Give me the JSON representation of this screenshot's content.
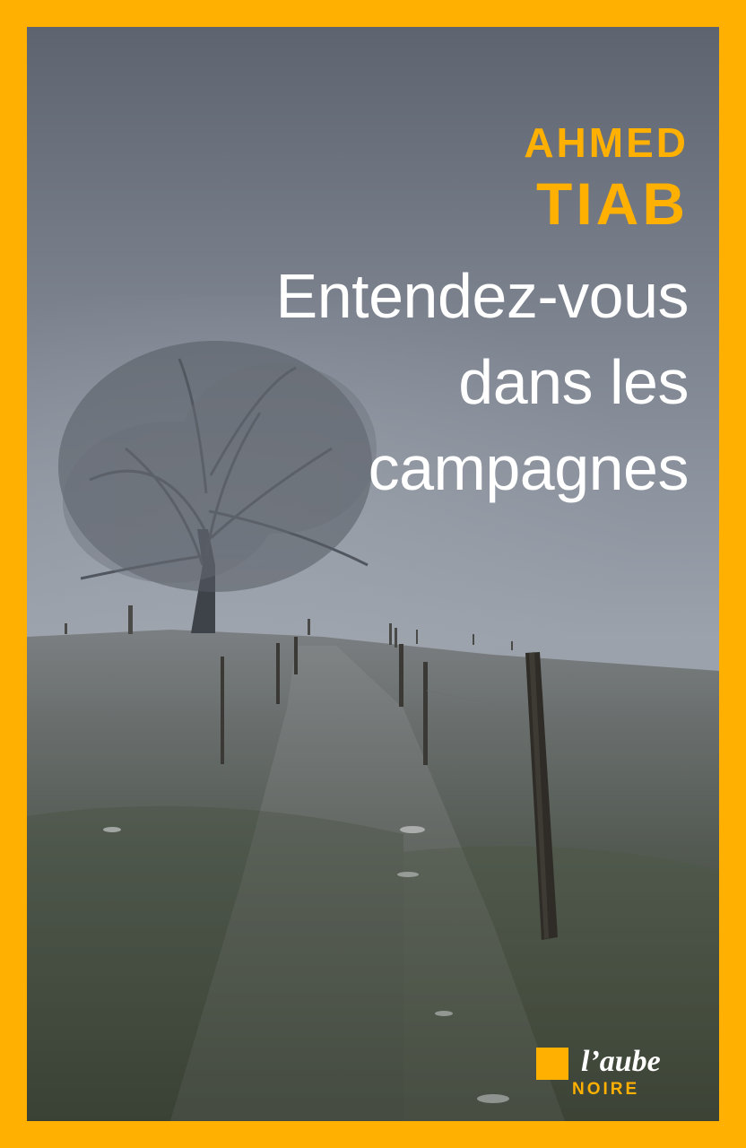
{
  "book": {
    "author_first": "AHMED",
    "author_last": "TIAB",
    "title_lines": [
      "Entendez-vous",
      "dans les",
      "campagnes"
    ]
  },
  "publisher": {
    "name": "l’aube",
    "collection": "NOIRE"
  },
  "colors": {
    "frame": "#ffb000",
    "title": "#ffffff",
    "author": "#ffb000"
  }
}
